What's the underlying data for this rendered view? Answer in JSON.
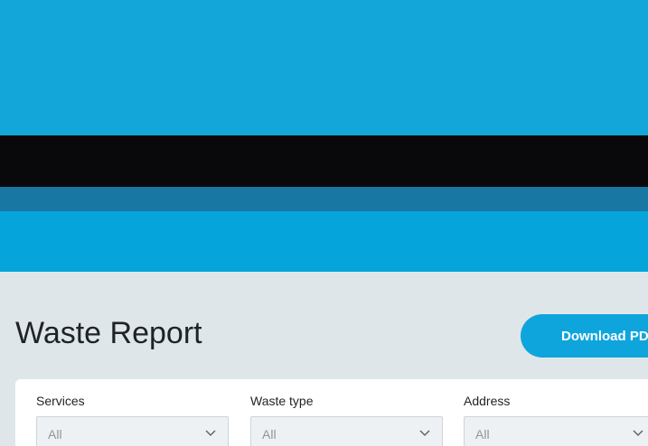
{
  "header": {
    "colors": {
      "top": "#13a6d9",
      "dark": "#09090c",
      "mid": "#1878a3",
      "bottom": "#05a5dc"
    }
  },
  "main": {
    "title": "Waste Report",
    "download_label": "Download PDF",
    "accent_color": "#0ea5dd"
  },
  "filters": [
    {
      "label": "Services",
      "value": "All",
      "icon": "chevron-down-icon"
    },
    {
      "label": "Waste type",
      "value": "All",
      "icon": "chevron-down-icon"
    },
    {
      "label": "Address",
      "value": "All",
      "icon": "chevron-down-icon"
    }
  ]
}
